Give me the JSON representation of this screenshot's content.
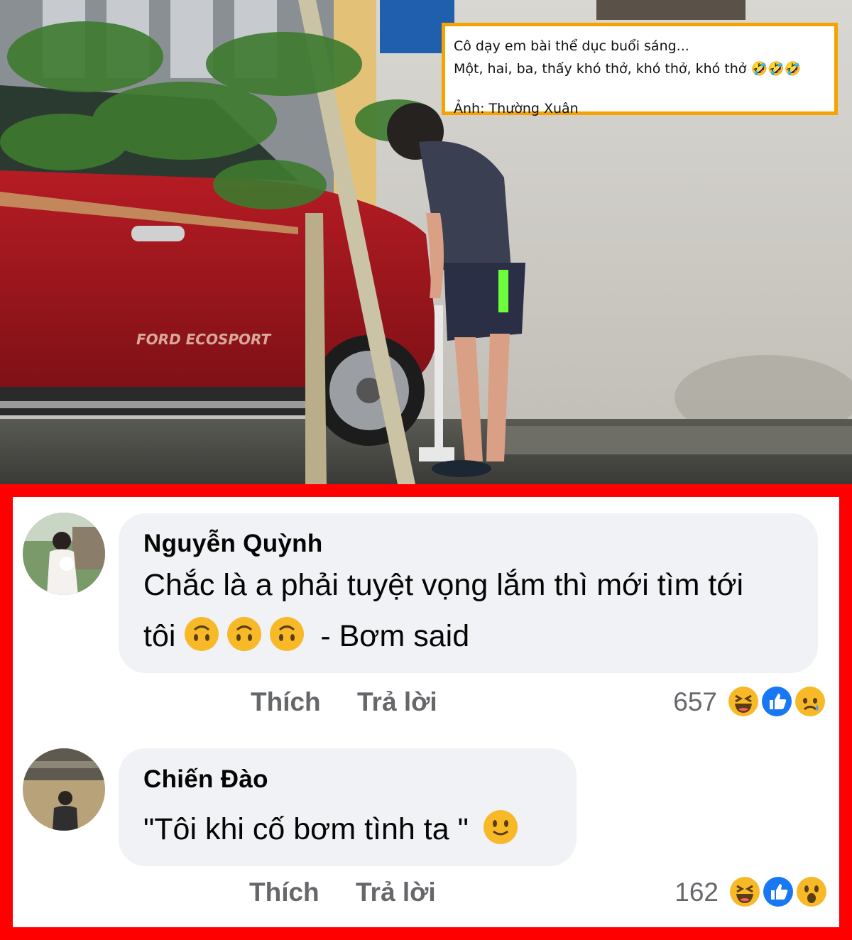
{
  "caption": {
    "line1": "Cô dạy em bài thể dục buổi sáng...",
    "line2": "Một, hai, ba, thấy khó thở, khó thở, khó thở 🤣🤣🤣",
    "line3": "Ảnh: Thường Xuân"
  },
  "photo": {
    "car_badge": "FORD ECOSPORT"
  },
  "comments": [
    {
      "author": "Nguyễn Quỳnh",
      "text_line1": "Chắc là a phải tuyệt vọng lắm thì mới tìm tới",
      "text_line2_prefix": "tôi",
      "text_line2_suffix": "- Bơm said",
      "like_label": "Thích",
      "reply_label": "Trả lời",
      "reaction_count": "657",
      "reactions": [
        "haha-icon",
        "like-icon",
        "sad-icon"
      ]
    },
    {
      "author": "Chiến Đào",
      "text": "\"Tôi khi cố bơm tình ta \"",
      "like_label": "Thích",
      "reply_label": "Trả lời",
      "reaction_count": "162",
      "reactions": [
        "haha-icon",
        "like-icon",
        "wow-icon"
      ]
    }
  ],
  "colors": {
    "frame_red": "#ff0000",
    "caption_border": "#f5a300",
    "bubble_bg": "#f0f2f5",
    "muted_text": "#65676b",
    "like_blue": "#1877f2"
  }
}
